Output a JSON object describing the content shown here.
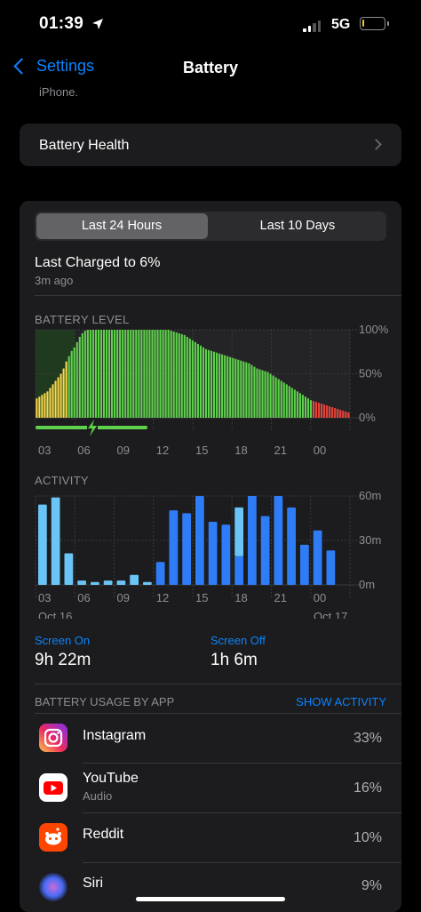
{
  "status": {
    "time": "01:39",
    "network": "5G"
  },
  "nav": {
    "back_label": "Settings",
    "title": "Battery"
  },
  "cut_text": "iPhone.",
  "health": {
    "label": "Battery Health"
  },
  "segment": {
    "options": [
      "Last 24 Hours",
      "Last 10 Days"
    ],
    "selected": "Last 24 Hours"
  },
  "charge": {
    "title": "Last Charged to 6%",
    "ago": "3m ago"
  },
  "battery_chart_label": "BATTERY LEVEL",
  "activity_chart_label": "ACTIVITY",
  "chart_data": [
    {
      "type": "bar",
      "title": "BATTERY LEVEL",
      "x_ticks": [
        "03",
        "06",
        "09",
        "12",
        "15",
        "18",
        "21",
        "00"
      ],
      "y_ticks": [
        "100%",
        "50%",
        "0%"
      ],
      "ylim": [
        0,
        100
      ],
      "grid": true,
      "colors": {
        "low": "#f7d74a",
        "normal": "#5fd14c",
        "critical": "#e8443a",
        "charging": "#5fd14c"
      },
      "values": [
        22,
        24,
        26,
        28,
        30,
        34,
        38,
        42,
        46,
        50,
        56,
        64,
        70,
        76,
        80,
        86,
        92,
        96,
        99,
        100,
        100,
        100,
        100,
        100,
        100,
        100,
        100,
        100,
        100,
        100,
        100,
        100,
        100,
        100,
        100,
        100,
        100,
        100,
        100,
        100,
        100,
        100,
        100,
        100,
        100,
        100,
        100,
        100,
        100,
        100,
        99,
        98,
        97,
        96,
        95,
        94,
        92,
        90,
        88,
        86,
        84,
        82,
        80,
        78,
        77,
        76,
        75,
        74,
        73,
        72,
        71,
        70,
        69,
        68,
        67,
        66,
        65,
        64,
        63,
        62,
        60,
        58,
        56,
        55,
        54,
        53,
        52,
        50,
        48,
        46,
        44,
        42,
        40,
        38,
        36,
        34,
        32,
        30,
        28,
        26,
        24,
        22,
        20,
        19,
        18,
        17,
        16,
        15,
        14,
        13,
        12,
        11,
        10,
        9,
        8,
        7,
        6
      ]
    },
    {
      "type": "bar",
      "title": "ACTIVITY",
      "x_ticks": [
        "03",
        "06",
        "09",
        "12",
        "15",
        "18",
        "21",
        "00"
      ],
      "date_labels": [
        "Oct 16",
        "Oct 17"
      ],
      "y_ticks": [
        "60m",
        "30m",
        "0m"
      ],
      "ylim": [
        0,
        60
      ],
      "grid": true,
      "legend": [
        "Screen On",
        "Screen Off"
      ],
      "colors": {
        "screen_on": "#2e7cf6",
        "screen_off": "#6ac4f5"
      },
      "series": [
        {
          "name": "Screen On",
          "values": [
            0,
            0,
            0,
            0,
            0,
            0,
            0,
            0,
            0,
            0,
            0,
            0,
            0,
            0,
            0,
            0,
            0,
            0,
            0,
            0,
            0,
            0,
            0,
            0,
            0,
            0,
            0,
            0,
            0,
            0,
            0,
            0,
            0,
            0,
            0,
            0,
            0,
            0,
            0,
            0,
            0,
            0,
            0,
            0,
            0,
            0,
            0,
            0,
            0,
            0,
            0,
            0,
            0,
            0,
            0,
            0,
            0,
            0,
            0,
            0,
            0,
            0,
            0,
            0,
            0,
            0,
            0,
            0,
            0,
            0,
            0,
            0,
            0,
            0,
            0,
            0,
            0,
            0,
            0,
            0,
            0,
            0,
            0,
            0,
            0,
            0,
            0,
            0,
            0,
            0,
            0,
            0,
            0,
            0,
            0,
            0,
            0,
            0,
            0,
            0
          ]
        }
      ],
      "bars": [
        {
          "on": 0,
          "off": 56
        },
        {
          "on": 0,
          "off": 61
        },
        {
          "on": 0,
          "off": 22
        },
        {
          "on": 0,
          "off": 3
        },
        {
          "on": 0,
          "off": 2
        },
        {
          "on": 0,
          "off": 3
        },
        {
          "on": 0,
          "off": 3
        },
        {
          "on": 0,
          "off": 7
        },
        {
          "on": 0,
          "off": 2
        },
        {
          "on": 16,
          "off": 0
        },
        {
          "on": 52,
          "off": 0
        },
        {
          "on": 50,
          "off": 0
        },
        {
          "on": 62,
          "off": 0
        },
        {
          "on": 44,
          "off": 0
        },
        {
          "on": 42,
          "off": 0
        },
        {
          "on": 20,
          "off": 34
        },
        {
          "on": 62,
          "off": 0
        },
        {
          "on": 48,
          "off": 0
        },
        {
          "on": 62,
          "off": 0
        },
        {
          "on": 54,
          "off": 0
        },
        {
          "on": 28,
          "off": 0
        },
        {
          "on": 38,
          "off": 0
        },
        {
          "on": 24,
          "off": 0
        }
      ]
    }
  ],
  "screen": {
    "on_label": "Screen On",
    "on_value": "9h 22m",
    "off_label": "Screen Off",
    "off_value": "1h 6m"
  },
  "usage": {
    "header": "BATTERY USAGE BY APP",
    "show_activity": "SHOW ACTIVITY",
    "apps": [
      {
        "name": "Instagram",
        "sub": "",
        "pct": "33%",
        "icon": "instagram-icon"
      },
      {
        "name": "YouTube",
        "sub": "Audio",
        "pct": "16%",
        "icon": "youtube-icon"
      },
      {
        "name": "Reddit",
        "sub": "",
        "pct": "10%",
        "icon": "reddit-icon"
      },
      {
        "name": "Siri",
        "sub": "",
        "pct": "9%",
        "icon": "siri-icon"
      }
    ]
  }
}
